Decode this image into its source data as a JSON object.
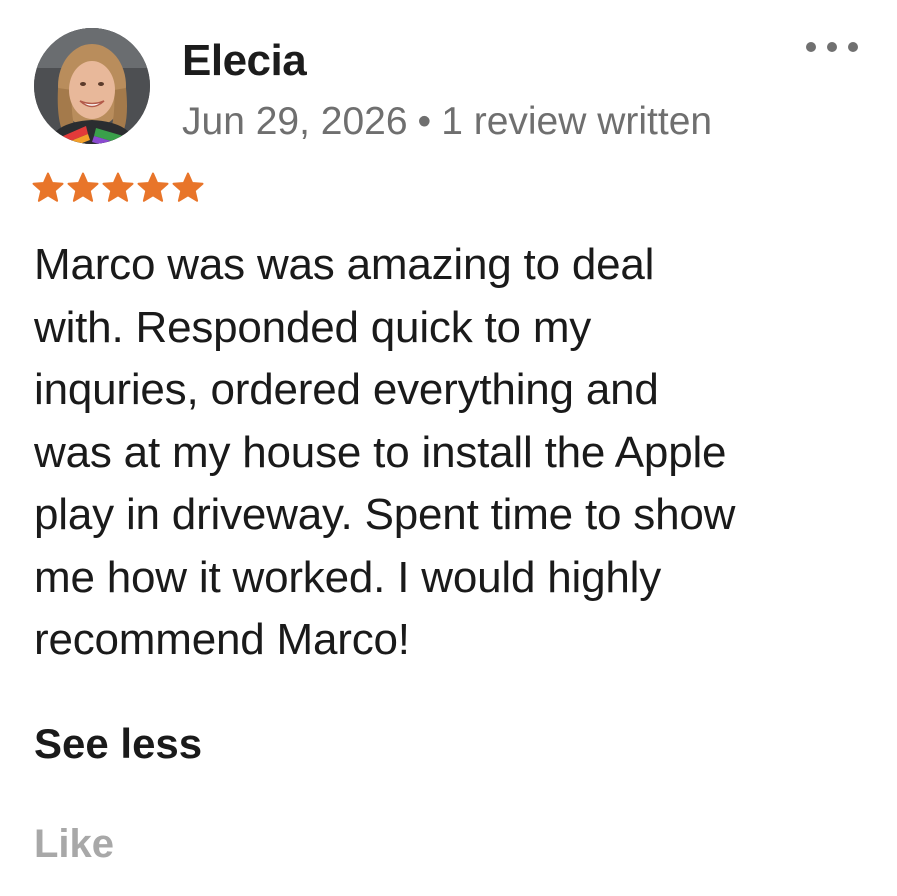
{
  "reviewer": {
    "name": "Elecia",
    "date": "Jun 29, 2026",
    "separator": "•",
    "review_count": "1 review written",
    "avatar_icon": "user-photo-icon"
  },
  "menu": {
    "icon": "more-options-icon"
  },
  "rating": {
    "stars": 5,
    "max": 5,
    "color": "#e8752a"
  },
  "review": {
    "lines": [
      "Marco was was amazing to deal",
      "with. Responded quick to my",
      "inquries, ordered everything and",
      "was at my house to install the Apple",
      "play in driveway. Spent time to show",
      "me how it worked. I would highly",
      "recommend Marco!"
    ]
  },
  "actions": {
    "see_less_label": "See less",
    "like_label": "Like"
  },
  "colors": {
    "text": "#1a1a1a",
    "meta": "#6f6f6f",
    "like": "#a8a8a8",
    "star": "#e8752a"
  }
}
